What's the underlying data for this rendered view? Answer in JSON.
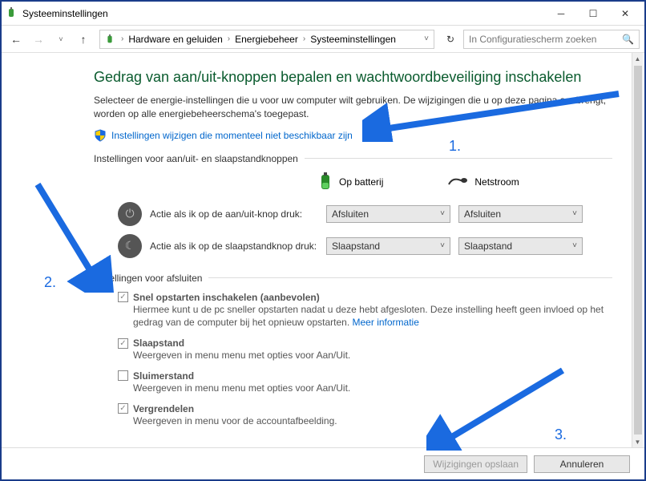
{
  "titlebar": {
    "title": "Systeeminstellingen"
  },
  "breadcrumb": {
    "items": [
      "Hardware en geluiden",
      "Energiebeheer",
      "Systeeminstellingen"
    ]
  },
  "search": {
    "placeholder": "In Configuratiescherm zoeken"
  },
  "page": {
    "heading": "Gedrag van aan/uit-knoppen bepalen en wachtwoordbeveiliging inschakelen",
    "desc": "Selecteer de energie-instellingen die u voor uw computer wilt gebruiken. De wijzigingen die u op deze pagina aanbrengt, worden op alle energiebeheerschema's toegepast.",
    "link": "Instellingen wijzigen die momenteel niet beschikbaar zijn",
    "section1": "Instellingen voor aan/uit- en slaapstandknoppen",
    "col_battery": "Op batterij",
    "col_plugged": "Netstroom",
    "row_power": "Actie als ik op de aan/uit-knop druk:",
    "row_sleep": "Actie als ik op de slaapstandknop druk:",
    "dd_shutdown": "Afsluiten",
    "dd_sleep": "Slaapstand",
    "section2": "Instellingen voor afsluiten",
    "fast_title": "Snel opstarten inschakelen (aanbevolen)",
    "fast_desc": "Hiermee kunt u de pc sneller opstarten nadat u deze hebt afgesloten. Deze instelling heeft geen invloed op het gedrag van de computer bij het opnieuw opstarten. ",
    "fast_more": "Meer informatie",
    "sleep_title": "Slaapstand",
    "sleep_desc": "Weergeven in menu menu met opties voor Aan/Uit.",
    "hiber_title": "Sluimerstand",
    "hiber_desc": "Weergeven in menu menu met opties voor Aan/Uit.",
    "lock_title": "Vergrendelen",
    "lock_desc": "Weergeven in menu voor de accountafbeelding.",
    "save": "Wijzigingen opslaan",
    "cancel": "Annuleren"
  },
  "annotations": {
    "n1": "1.",
    "n2": "2.",
    "n3": "3."
  }
}
